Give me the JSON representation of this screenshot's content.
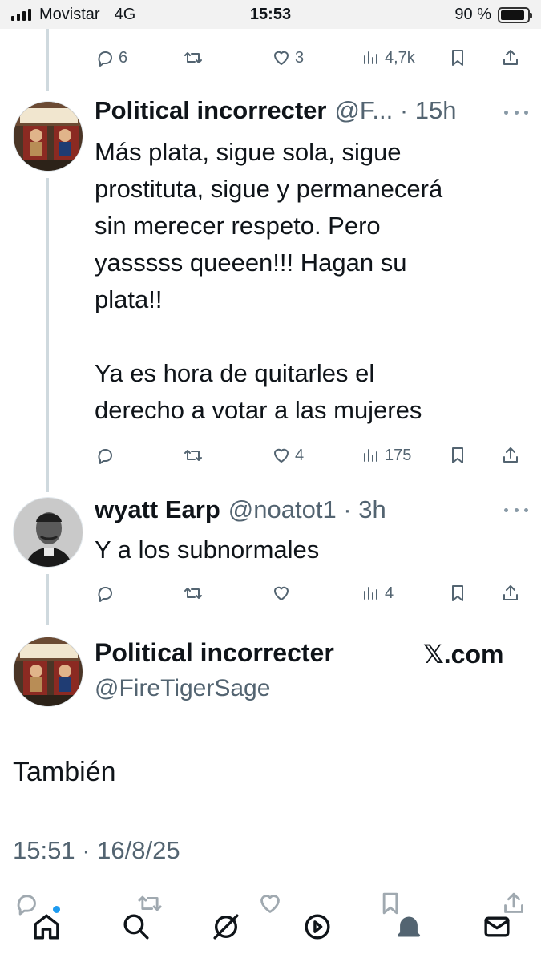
{
  "status_bar": {
    "carrier": "Movistar",
    "network": "4G",
    "time": "15:53",
    "battery_text": "90 %",
    "battery_level": 0.9
  },
  "tweets": [
    {
      "actions": {
        "replies": "6",
        "retweets": "",
        "likes": "3",
        "views": "4,7k"
      }
    },
    {
      "name": "Political incorrecter",
      "meta": "@F... · 15h",
      "text_lines": [
        "Más plata, sigue sola, sigue",
        "prostituta, sigue y permanecerá",
        "sin merecer respeto. Pero",
        "yasssss queeen!!! Hagan su",
        "plata!!",
        "",
        "Ya es hora de quitarles el",
        "derecho a votar a las mujeres"
      ],
      "actions": {
        "replies": "",
        "retweets": "",
        "likes": "4",
        "views": "175"
      }
    },
    {
      "name": "wyatt Earp",
      "meta": "@noatot1 · 3h",
      "text_lines": [
        "Y a los subnormales"
      ],
      "actions": {
        "replies": "",
        "retweets": "",
        "likes": "",
        "views": "4"
      }
    }
  ],
  "main_tweet": {
    "name": "Political incorrecter",
    "handle": "@FireTigerSage",
    "watermark": "𝕏.com",
    "text": "También",
    "timestamp": "15:51 · 16/8/25"
  },
  "icons": {
    "reply": "reply-icon",
    "retweet": "retweet-icon",
    "like": "heart-icon",
    "views": "views-icon",
    "bookmark": "bookmark-icon",
    "share": "share-icon",
    "nav": [
      "home-icon",
      "search-icon",
      "grok-icon",
      "video-icon",
      "notifications-icon",
      "messages-icon"
    ]
  },
  "colors": {
    "text": "#0f1419",
    "muted": "#536471",
    "accent": "#1d9bf0",
    "thread": "#cfd9de"
  }
}
